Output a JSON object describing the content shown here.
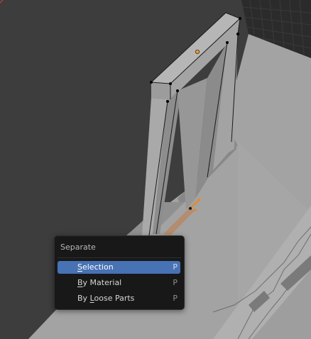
{
  "viewport": {
    "name": "3D Viewport"
  },
  "separate_menu": {
    "title": "Separate",
    "items": [
      {
        "label_first": "S",
        "label_rest": "election",
        "shortcut": "P",
        "active": true
      },
      {
        "label_first": "B",
        "label_rest": "y Material",
        "shortcut": "P",
        "active": false
      },
      {
        "label_pre": "By ",
        "label_first": "L",
        "label_rest": "oose Parts",
        "shortcut": "P",
        "active": false
      }
    ]
  },
  "colors": {
    "viewport_bg": "#3d3d3d",
    "mesh_face": "#9b9b9b",
    "floor": "#a8a8a8",
    "grid": "#262626",
    "selected_vertex": "#e88b1e",
    "menu_bg": "#181818",
    "menu_highlight": "#4772b3"
  },
  "icons": {
    "selected_edge": "orange-edge",
    "origin": "object-origin-dot"
  }
}
